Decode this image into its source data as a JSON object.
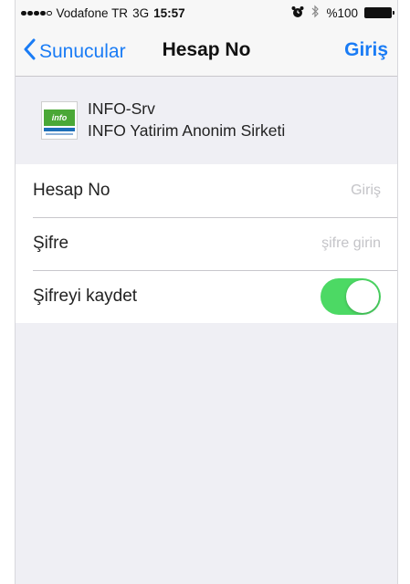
{
  "status_bar": {
    "carrier": "Vodafone TR",
    "network": "3G",
    "time": "15:57",
    "battery": "%100",
    "signal_dots_filled": 4,
    "signal_dots_total": 5
  },
  "nav": {
    "back_label": "Sunucular",
    "title": "Hesap No",
    "action_label": "Giriş"
  },
  "server": {
    "logo_text": "info",
    "name": "INFO-Srv",
    "company": "INFO Yatirim Anonim Sirketi"
  },
  "form": {
    "account": {
      "label": "Hesap No",
      "value": "",
      "placeholder": "Giriş"
    },
    "password": {
      "label": "Şifre",
      "value": "",
      "placeholder": "şifre girin"
    },
    "save_password": {
      "label": "Şifreyi kaydet",
      "on": true
    }
  },
  "colors": {
    "accent": "#1a7cf5",
    "toggle_on": "#4cd964",
    "background": "#efeff4"
  }
}
